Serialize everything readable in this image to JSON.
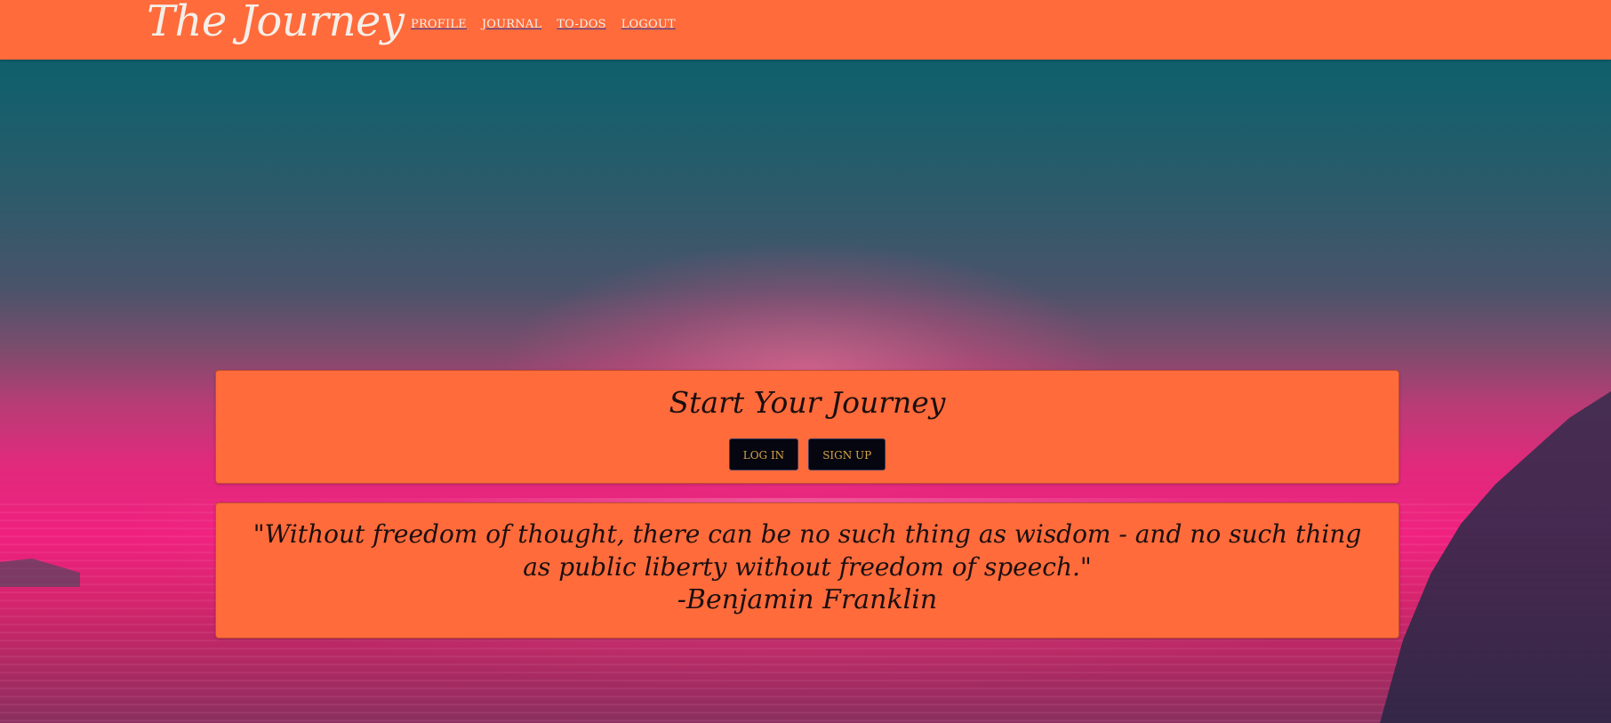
{
  "navbar": {
    "brand": "The Journey",
    "links": [
      "PROFILE",
      "JOURNAL",
      "TO-DOS",
      "LOGOUT"
    ]
  },
  "start_card": {
    "title": "Start Your Journey",
    "login_label": "LOG IN",
    "signup_label": "SIGN UP"
  },
  "quote_card": {
    "quote": "\"Without freedom of thought, there can be no such thing as wisdom - and no such thing as public liberty without freedom of speech.\"",
    "author": "-Benjamin Franklin"
  },
  "colors": {
    "accent": "#ff6b3b",
    "button_bg": "#05060f",
    "button_text": "#d9a54a",
    "brand_text": "#f6efe9"
  },
  "background": {
    "description_icon": "sunset-over-ocean-image"
  }
}
